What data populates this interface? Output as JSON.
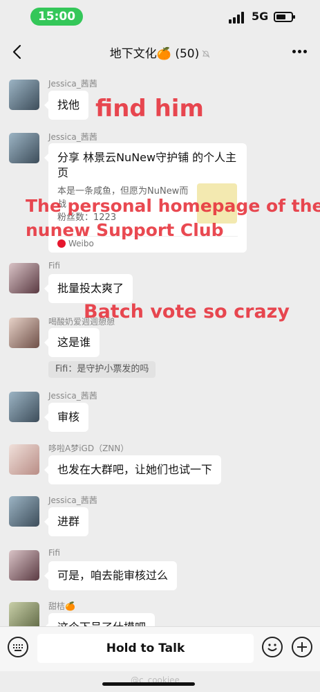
{
  "status": {
    "time": "15:00",
    "network": "5G"
  },
  "nav": {
    "title": "地下文化🍊 (50)"
  },
  "messages": [
    {
      "sender": "Jessica_茜茜",
      "text": "找他"
    },
    {
      "sender": "Jessica_茜茜",
      "card": {
        "title": "分享 林景云NuNew守护铺 的个人主页",
        "desc": "本是一条咸鱼，但愿为NuNew而战",
        "fans": "粉丝数：1223",
        "source": "Weibo"
      }
    },
    {
      "sender": "Fifi",
      "text": "批量投太爽了"
    },
    {
      "sender": "喝酸奶爱週週憩憩",
      "text": "这是谁",
      "quote": "Fifi：是守护小票发的吗"
    },
    {
      "sender": "Jessica_茜茜",
      "text": "审核"
    },
    {
      "sender": "哆啦A梦iGD（ZNN）",
      "text": "也发在大群吧，让她们也试一下"
    },
    {
      "sender": "Jessica_茜茜",
      "text": "进群"
    },
    {
      "sender": "Fifi",
      "text": "可是，咱去能审核过么"
    },
    {
      "sender": "甜桔🍊",
      "text": "这个下号了什摸吧"
    }
  ],
  "overlays": {
    "find": "find him",
    "homepage_line1": "The personal homepage of the",
    "homepage_line2": "nunew Support Club",
    "batch": "Batch vote so crazy"
  },
  "inputbar": {
    "hold_label": "Hold to Talk"
  },
  "watermark": "@c_cookiee",
  "colors": {
    "accent_green": "#34c759",
    "overlay_red": "#e7303a",
    "bubble": "#ffffff",
    "background": "#ededed"
  }
}
